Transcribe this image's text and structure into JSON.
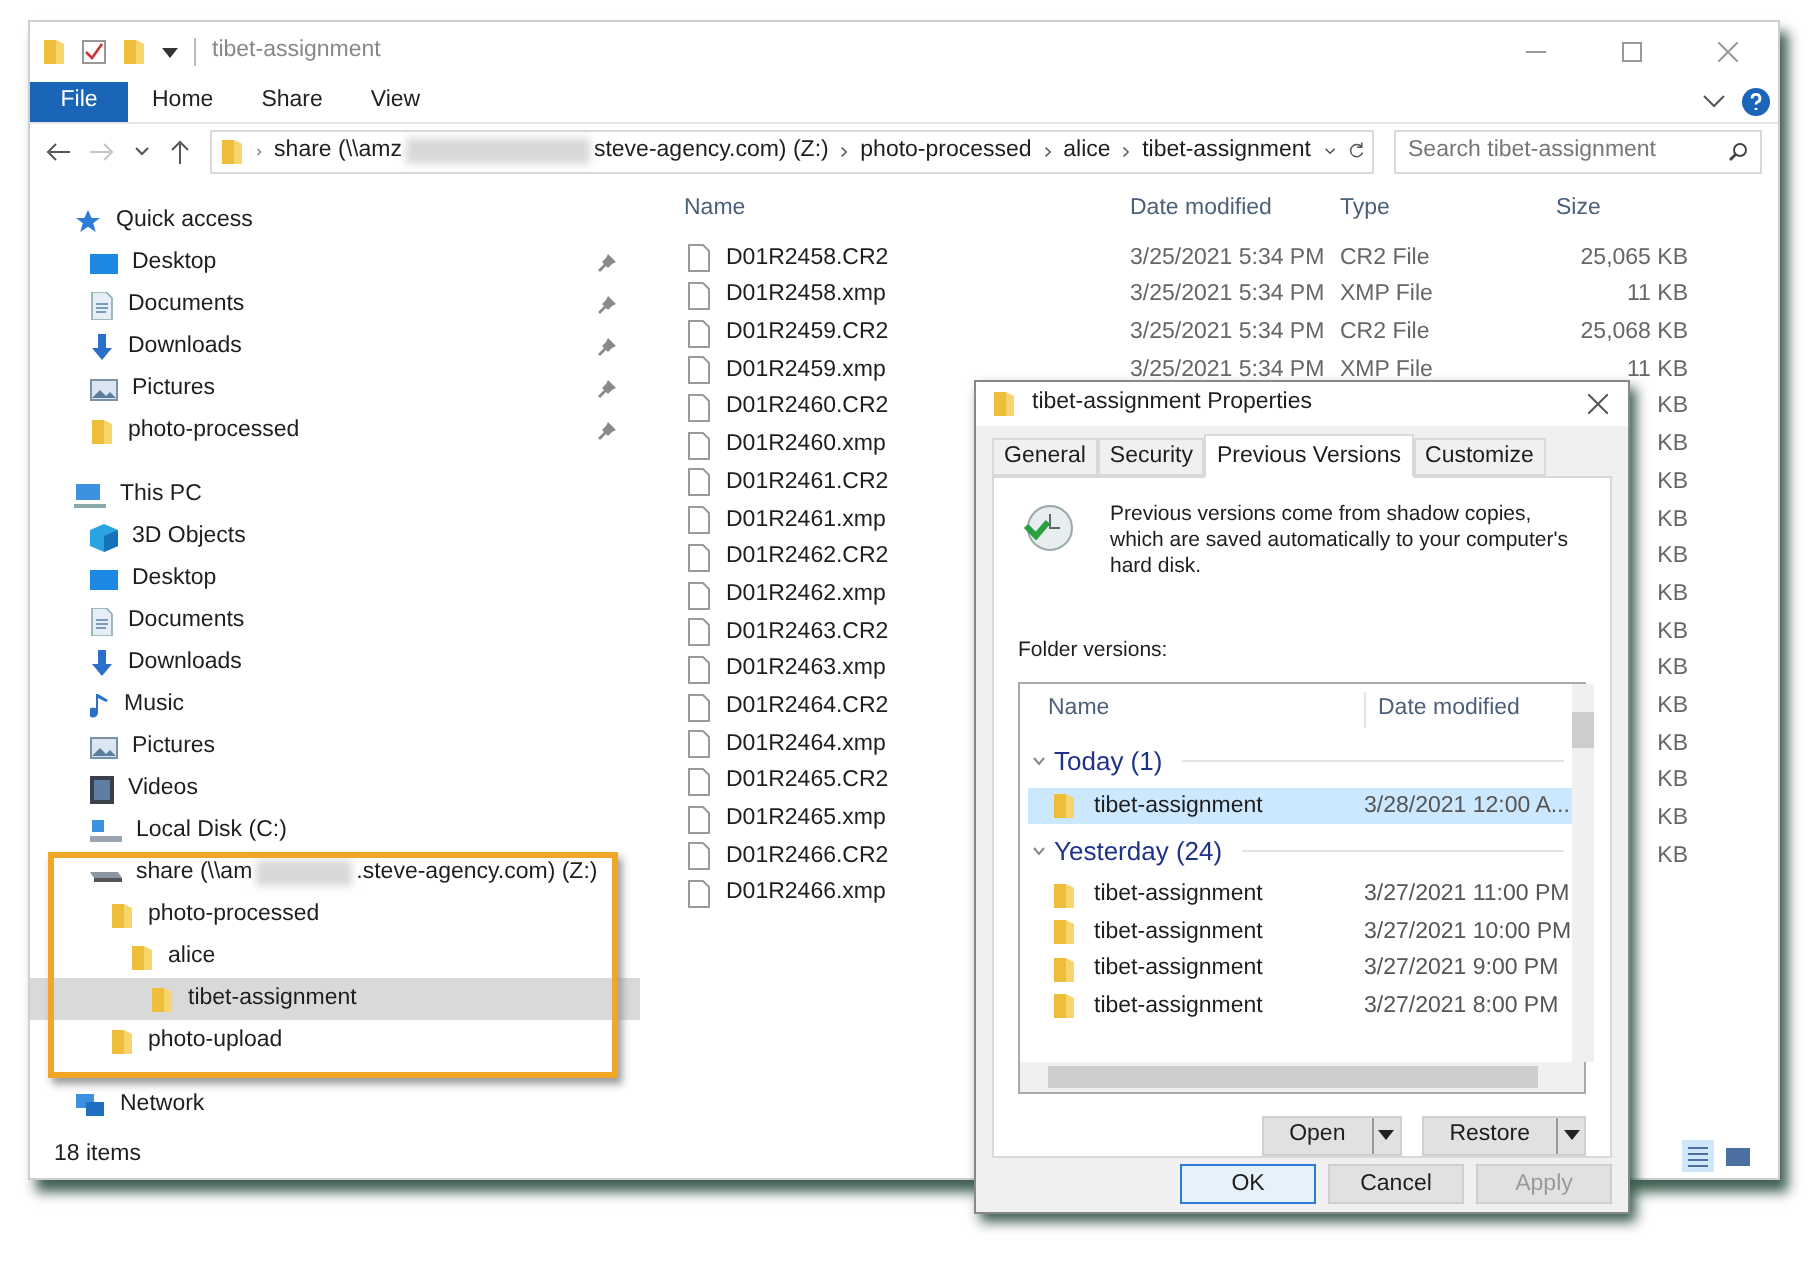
{
  "window": {
    "title": "tibet-assignment"
  },
  "ribbon_tabs": [
    {
      "label": "File",
      "kind": "file"
    },
    {
      "label": "Home",
      "kind": "tab"
    },
    {
      "label": "Share",
      "kind": "tab"
    },
    {
      "label": "View",
      "kind": "tab"
    }
  ],
  "address": {
    "text_before_redaction": "share (\\\\amz",
    "text_after_redaction": "steve-agency.com) (Z:)",
    "crumbs": [
      "photo-processed",
      "alice",
      "tibet-assignment"
    ]
  },
  "search": {
    "placeholder": "Search tibet-assignment"
  },
  "sidebar": {
    "items": [
      {
        "label": "Quick access",
        "kind": "star",
        "selected": false,
        "children": [
          {
            "label": "Desktop",
            "kind": "desktop",
            "pinned": true,
            "selected": false
          },
          {
            "label": "Documents",
            "kind": "documents",
            "pinned": true,
            "selected": false
          },
          {
            "label": "Downloads",
            "kind": "downloads",
            "pinned": true,
            "selected": false
          },
          {
            "label": "Pictures",
            "kind": "pictures",
            "pinned": true,
            "selected": false
          },
          {
            "label": "photo-processed",
            "kind": "folder",
            "pinned": true,
            "selected": false
          }
        ]
      },
      {
        "label": "This PC",
        "kind": "pc",
        "selected": false,
        "children": [
          {
            "label": "3D Objects",
            "kind": "cube",
            "selected": false
          },
          {
            "label": "Desktop",
            "kind": "desktop",
            "selected": false
          },
          {
            "label": "Documents",
            "kind": "documents",
            "selected": false
          },
          {
            "label": "Downloads",
            "kind": "downloads",
            "selected": false
          },
          {
            "label": "Music",
            "kind": "music",
            "selected": false
          },
          {
            "label": "Pictures",
            "kind": "pictures",
            "selected": false
          },
          {
            "label": "Videos",
            "kind": "videos",
            "selected": false
          },
          {
            "label": "Local Disk (C:)",
            "kind": "disk",
            "selected": false
          },
          {
            "label": "share (\\\\am",
            "label_after_redaction": ".steve-agency.com) (Z:)",
            "kind": "netdrive",
            "selected": false,
            "children": [
              {
                "label": "photo-processed",
                "kind": "folder",
                "selected": false,
                "children": [
                  {
                    "label": "alice",
                    "kind": "folder",
                    "selected": false,
                    "children": [
                      {
                        "label": "tibet-assignment",
                        "kind": "folder",
                        "selected": true
                      }
                    ]
                  }
                ]
              },
              {
                "label": "photo-upload",
                "kind": "folder",
                "selected": false
              }
            ]
          }
        ]
      },
      {
        "label": "Network",
        "kind": "network",
        "selected": false
      }
    ]
  },
  "table": {
    "columns": [
      "Name",
      "Date modified",
      "Type",
      "Size"
    ],
    "rows": [
      {
        "name": "D01R2458.CR2",
        "date": "3/25/2021 5:34 PM",
        "type": "CR2 File",
        "size": "25,065 KB"
      },
      {
        "name": "D01R2458.xmp",
        "date": "3/25/2021 5:34 PM",
        "type": "XMP File",
        "size": "11 KB"
      },
      {
        "name": "D01R2459.CR2",
        "date": "3/25/2021 5:34 PM",
        "type": "CR2 File",
        "size": "25,068 KB"
      },
      {
        "name": "D01R2459.xmp",
        "date": "3/25/2021 5:34 PM",
        "type": "XMP File",
        "size": "11 KB"
      },
      {
        "name": "D01R2460.CR2",
        "size": "KB"
      },
      {
        "name": "D01R2460.xmp",
        "size": "KB"
      },
      {
        "name": "D01R2461.CR2",
        "size": "KB"
      },
      {
        "name": "D01R2461.xmp",
        "size": "KB"
      },
      {
        "name": "D01R2462.CR2",
        "size": "KB"
      },
      {
        "name": "D01R2462.xmp",
        "size": "KB"
      },
      {
        "name": "D01R2463.CR2",
        "size": "KB"
      },
      {
        "name": "D01R2463.xmp",
        "size": "KB"
      },
      {
        "name": "D01R2464.CR2",
        "size": "KB"
      },
      {
        "name": "D01R2464.xmp",
        "size": "KB"
      },
      {
        "name": "D01R2465.CR2",
        "size": "KB"
      },
      {
        "name": "D01R2465.xmp",
        "size": "KB"
      },
      {
        "name": "D01R2466.CR2",
        "size": "KB"
      },
      {
        "name": "D01R2466.xmp"
      }
    ]
  },
  "status_bar": {
    "text": "18 items"
  },
  "dialog": {
    "title": "tibet-assignment Properties",
    "tabs": [
      {
        "label": "General",
        "selected": false
      },
      {
        "label": "Security",
        "selected": false
      },
      {
        "label": "Previous Versions",
        "selected": true
      },
      {
        "label": "Customize",
        "selected": false
      }
    ],
    "info": "Previous versions come from shadow copies, which are saved automatically to your computer's hard disk.",
    "list_label": "Folder versions:",
    "columns": [
      "Name",
      "Date modified"
    ],
    "groups": [
      {
        "title": "Today (1)",
        "items": [
          {
            "name": "tibet-assignment",
            "date": "3/28/2021 12:00 A...",
            "selected": true
          }
        ]
      },
      {
        "title": "Yesterday (24)",
        "items": [
          {
            "name": "tibet-assignment",
            "date": "3/27/2021 11:00 PM",
            "selected": false
          },
          {
            "name": "tibet-assignment",
            "date": "3/27/2021 10:00 PM",
            "selected": false
          },
          {
            "name": "tibet-assignment",
            "date": "3/27/2021 9:00 PM",
            "selected": false
          },
          {
            "name": "tibet-assignment",
            "date": "3/27/2021 8:00 PM",
            "selected": false
          }
        ]
      }
    ],
    "split_buttons": [
      "Open",
      "Restore"
    ],
    "buttons": [
      {
        "label": "OK",
        "kind": "default",
        "disabled": false
      },
      {
        "label": "Cancel",
        "kind": "normal",
        "disabled": false
      },
      {
        "label": "Apply",
        "kind": "normal",
        "disabled": true
      }
    ]
  }
}
